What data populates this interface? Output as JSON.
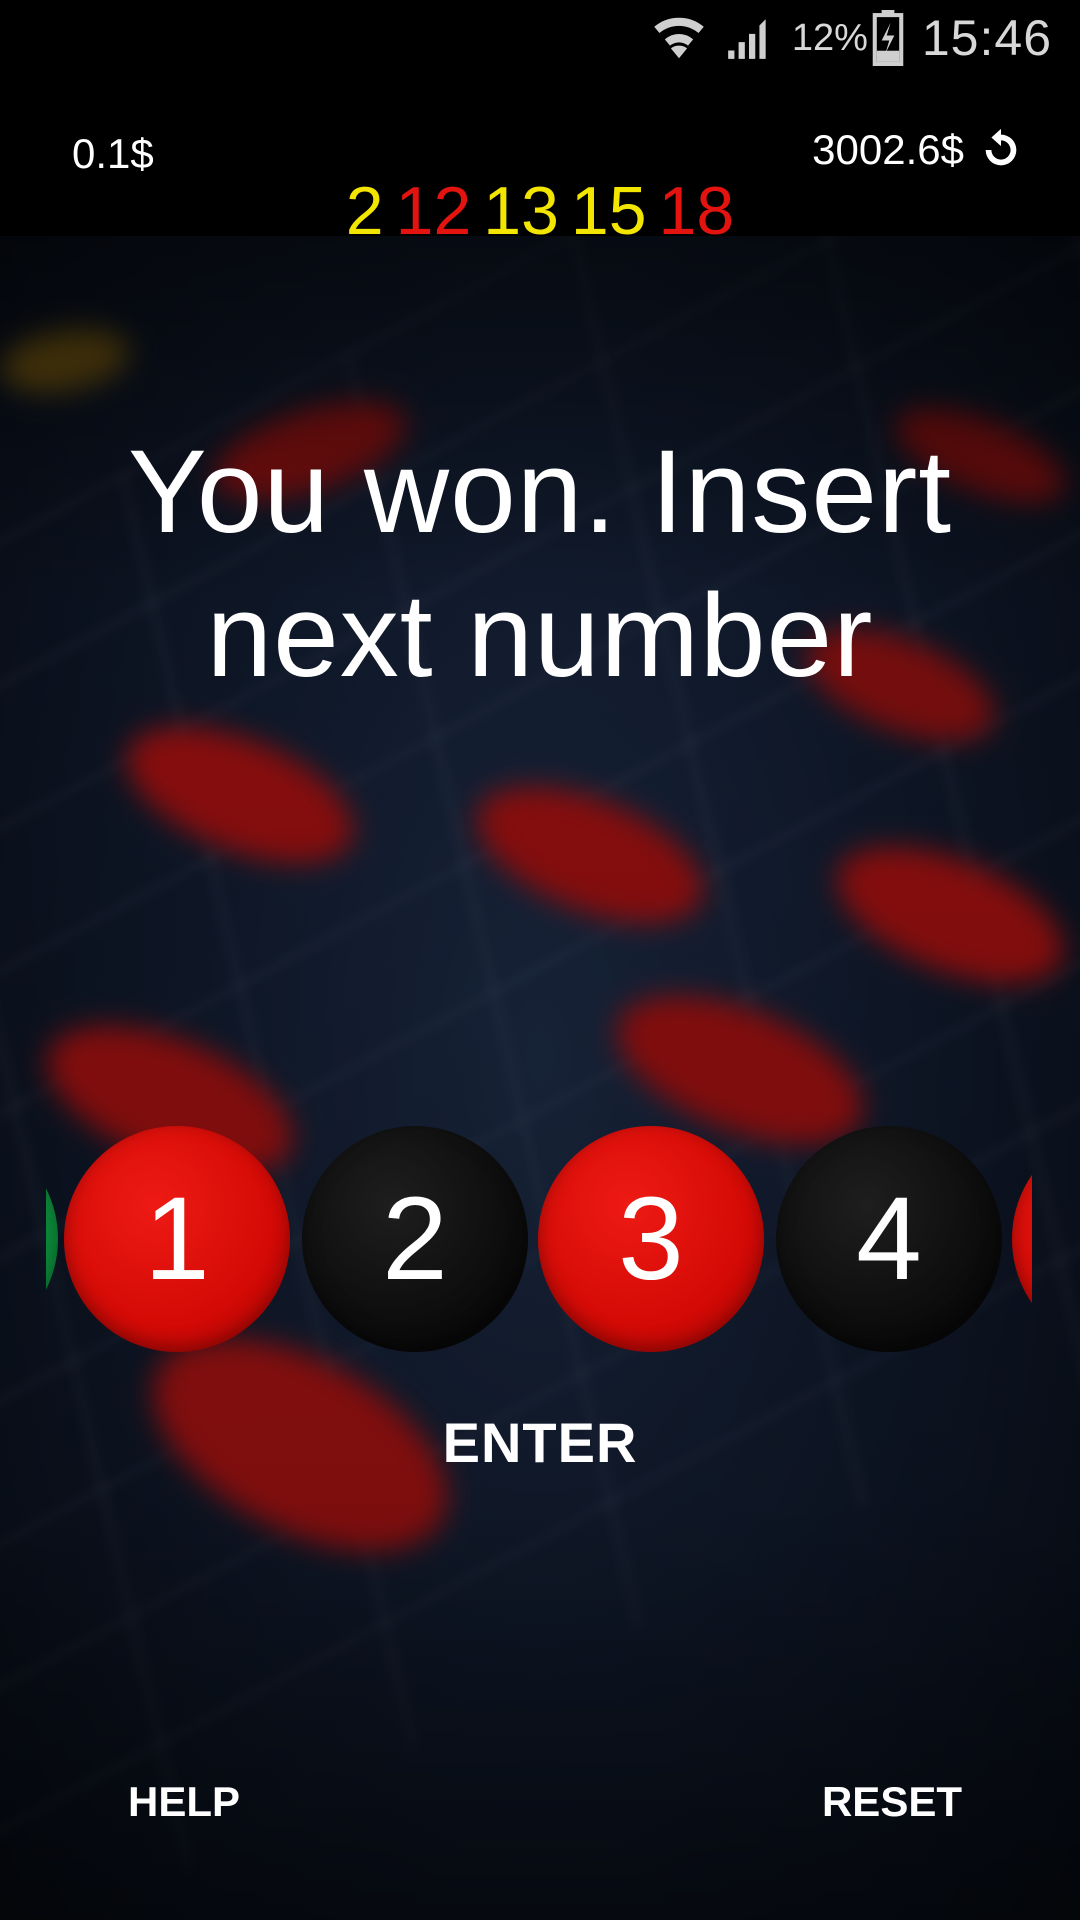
{
  "status_bar": {
    "icons": [
      "wifi-icon",
      "signal-icon",
      "battery-charging-icon"
    ],
    "battery_percent": "12%",
    "time": "15:46"
  },
  "header": {
    "bet": "0.1$",
    "balance": "3002.6$",
    "refresh_icon": "refresh-icon"
  },
  "history": [
    {
      "value": "2",
      "color": "#f2e600"
    },
    {
      "value": "12",
      "color": "#e3140f"
    },
    {
      "value": "13",
      "color": "#f2e600"
    },
    {
      "value": "15",
      "color": "#f2e600"
    },
    {
      "value": "18",
      "color": "#e3140f"
    }
  ],
  "message": "You won. Insert next number",
  "number_picker": {
    "chips": [
      {
        "value": "",
        "color": "green"
      },
      {
        "value": "1",
        "color": "red"
      },
      {
        "value": "2",
        "color": "black"
      },
      {
        "value": "3",
        "color": "red"
      },
      {
        "value": "4",
        "color": "black"
      },
      {
        "value": "",
        "color": "red"
      }
    ]
  },
  "actions": {
    "enter": "ENTER",
    "help": "HELP",
    "reset": "RESET"
  },
  "colors": {
    "red": "#d40a06",
    "black": "#0b0b0b",
    "yellow": "#f2e600"
  }
}
